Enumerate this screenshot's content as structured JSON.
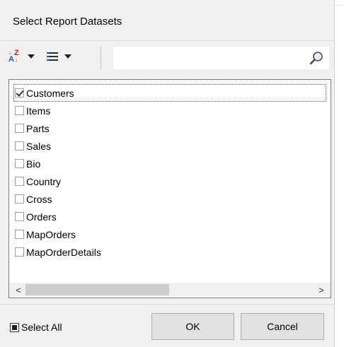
{
  "dialog": {
    "title": "Select Report Datasets"
  },
  "toolbar": {
    "sort_icon": "sort-az-icon",
    "list_icon": "list-view-icon",
    "search": {
      "value": "",
      "icon": "magnifier-icon"
    }
  },
  "datasets": [
    {
      "label": "Customers",
      "checked": true
    },
    {
      "label": "Items",
      "checked": false
    },
    {
      "label": "Parts",
      "checked": false
    },
    {
      "label": "Sales",
      "checked": false
    },
    {
      "label": "Bio",
      "checked": false
    },
    {
      "label": "Country",
      "checked": false
    },
    {
      "label": "Cross",
      "checked": false
    },
    {
      "label": "Orders",
      "checked": false
    },
    {
      "label": "MapOrders",
      "checked": false
    },
    {
      "label": "MapOrderDetails",
      "checked": false
    }
  ],
  "footer": {
    "select_all_label": "Select All",
    "select_all_state": "indeterminate",
    "ok_label": "OK",
    "cancel_label": "Cancel"
  },
  "scrollbar": {
    "left_arrow": "<",
    "right_arrow": ">"
  }
}
